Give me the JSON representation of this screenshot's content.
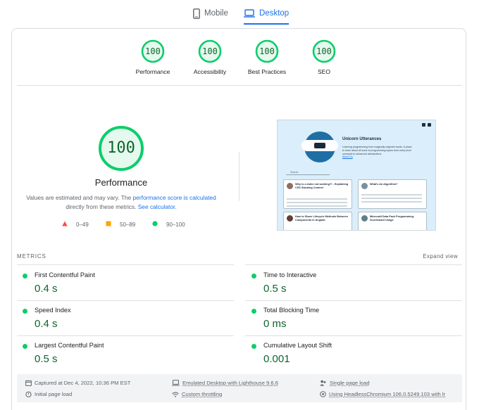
{
  "tabs": {
    "mobile_label": "Mobile",
    "desktop_label": "Desktop",
    "active": "Desktop"
  },
  "categories": [
    {
      "label": "Performance",
      "score": "100"
    },
    {
      "label": "Accessibility",
      "score": "100"
    },
    {
      "label": "Best Practices",
      "score": "100"
    },
    {
      "label": "SEO",
      "score": "100"
    }
  ],
  "performance": {
    "score": "100",
    "title": "Performance",
    "desc_prefix": "Values are estimated and may vary. The ",
    "desc_link1": "performance score is calculated",
    "desc_middle": "directly from these metrics. ",
    "desc_link2": "See calculator."
  },
  "legend": [
    {
      "range": "0–49",
      "shape": "triangle",
      "color": "#ff4e42"
    },
    {
      "range": "50–89",
      "shape": "square",
      "color": "#ffa400"
    },
    {
      "range": "90–100",
      "shape": "circle",
      "color": "#0cce6b"
    }
  ],
  "screenshot": {
    "site_title": "Unicorn Utterances",
    "site_subtitle": "Learning programming from magically majestic words. A place to learn about all sorts of programming topics from entry-level concepts to advanced abstractions",
    "site_link": "About Us",
    "search_placeholder": "Search",
    "posts": [
      "Why is z-index not working?! - Explaining CSS Stacking Context",
      "What's An Algorithm?",
      "How to Share Lifecycle Methods Between Components in Angular",
      "Minecraft Data Pack Programming: Scoreboard Usage"
    ]
  },
  "metrics": {
    "section_label": "METRICS",
    "expand_label": "Expand view",
    "items": [
      {
        "name": "First Contentful Paint",
        "value": "0.4 s"
      },
      {
        "name": "Time to Interactive",
        "value": "0.5 s"
      },
      {
        "name": "Speed Index",
        "value": "0.4 s"
      },
      {
        "name": "Total Blocking Time",
        "value": "0 ms"
      },
      {
        "name": "Largest Contentful Paint",
        "value": "0.5 s"
      },
      {
        "name": "Cumulative Layout Shift",
        "value": "0.001"
      }
    ]
  },
  "footer": {
    "captured": "Captured at Dec 4, 2022, 10:36 PM EST",
    "initial_load": "Initial page load",
    "emulated": "Emulated Desktop with Lighthouse 9.6.6",
    "throttling": "Custom throttling",
    "single_page": "Single page load",
    "using": "Using HeadlessChromium 106.0.5249.103 with lr"
  },
  "colors": {
    "accent": "#1a73e8",
    "pass": "#0cce6b",
    "pass_text": "#0d652d"
  }
}
